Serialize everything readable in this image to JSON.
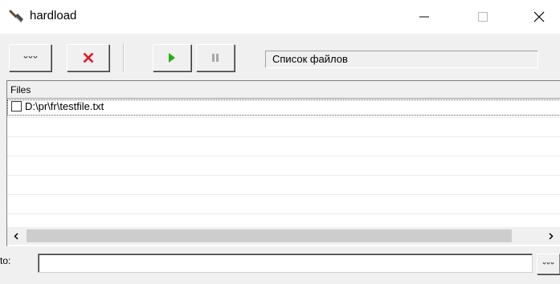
{
  "window": {
    "title": "hardload",
    "app_icon": "shovel-icon"
  },
  "toolbar": {
    "browse_icon": "ellipsis-icon",
    "remove_icon": "red-x-icon",
    "start_icon": "play-icon",
    "pause_icon": "pause-icon",
    "status_text": "Список файлов"
  },
  "file_list": {
    "column_header": "Files",
    "items": [
      {
        "path": "D:\\pr\\fr\\testfile.txt",
        "checked": false
      }
    ]
  },
  "destination": {
    "label": "to:",
    "value": "",
    "browse_icon": "ellipsis-icon"
  },
  "colors": {
    "accent_red": "#e81123",
    "play_green": "#22b014",
    "face": "#f0f0f0"
  }
}
